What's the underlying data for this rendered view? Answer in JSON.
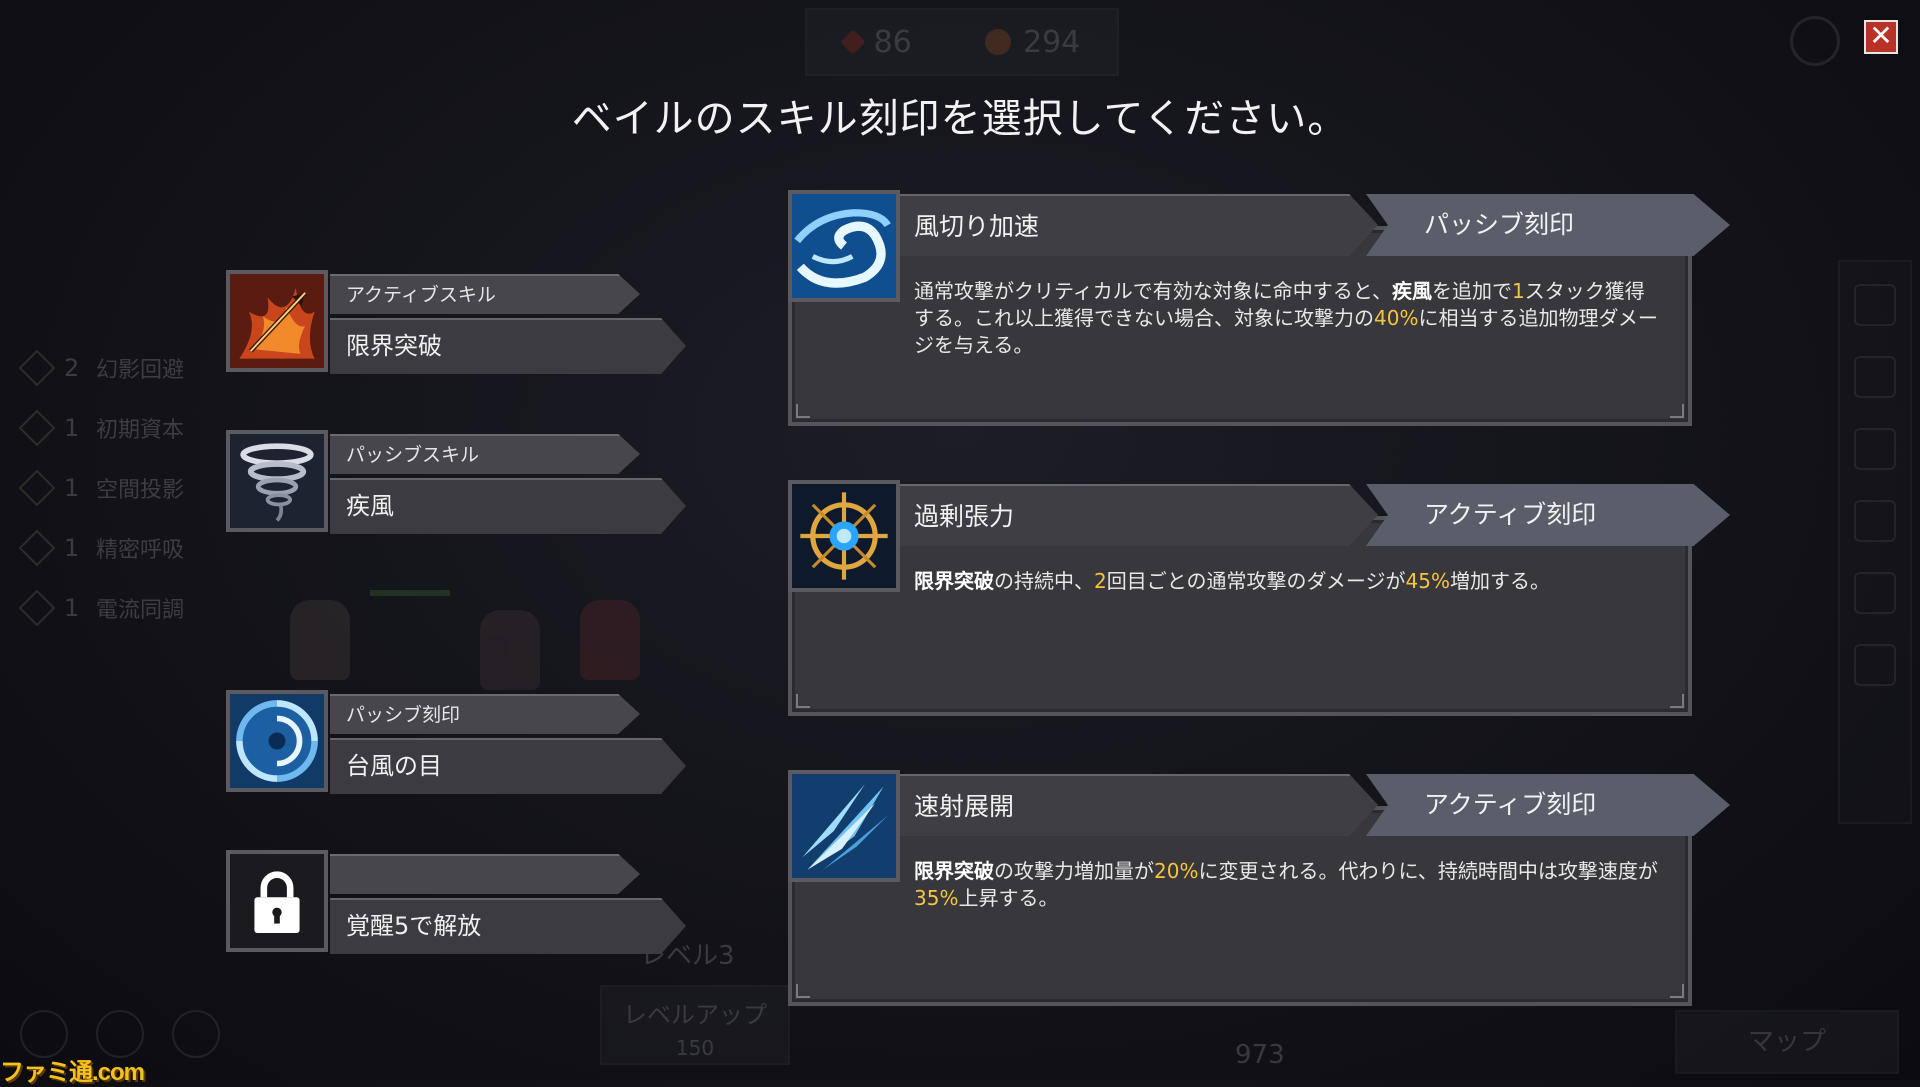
{
  "resources": [
    {
      "icon": "fire-icon",
      "value": "86"
    },
    {
      "icon": "coin-icon",
      "value": "294"
    }
  ],
  "background_list": [
    {
      "count": "2",
      "label": "幻影回避"
    },
    {
      "count": "1",
      "label": "初期資本"
    },
    {
      "count": "1",
      "label": "空間投影"
    },
    {
      "count": "1",
      "label": "精密呼吸"
    },
    {
      "count": "1",
      "label": "電流同調"
    }
  ],
  "background_ui": {
    "level": "レベル3",
    "levelup_label": "レベルアップ",
    "levelup_cost": "150",
    "gold": "973",
    "map_button": "マップ"
  },
  "title": "ベイルのスキル刻印を選択してください。",
  "close_symbol": "✕",
  "skill_slots": [
    {
      "type": "アクティブスキル",
      "name": "限界突破",
      "icon": "arrow-burst-icon"
    },
    {
      "type": "パッシブスキル",
      "name": "疾風",
      "icon": "tornado-icon"
    },
    {
      "type": "パッシブ刻印",
      "name": "台風の目",
      "icon": "typhoon-eye-icon"
    },
    {
      "type": "",
      "name": "覚醒5で解放",
      "icon": "lock-icon"
    }
  ],
  "options": [
    {
      "name": "風切り加速",
      "type": "パッシブ刻印",
      "icon": "wind-swirl-icon",
      "desc": [
        {
          "t": "通常攻撃がクリティカルで有効な対象に命中すると、"
        },
        {
          "t": "疾風",
          "s": "bold"
        },
        {
          "t": "を追加で"
        },
        {
          "t": "1",
          "s": "hl"
        },
        {
          "t": "スタック獲得する。これ以上獲得できない場合、対象に攻撃力の"
        },
        {
          "t": "40%",
          "s": "hl"
        },
        {
          "t": "に相当する追加物理ダメージを与える。"
        }
      ]
    },
    {
      "name": "過剰張力",
      "type": "アクティブ刻印",
      "icon": "crosshair-wheel-icon",
      "desc": [
        {
          "t": "限界突破",
          "s": "bold"
        },
        {
          "t": "の持続中、"
        },
        {
          "t": "2",
          "s": "hl"
        },
        {
          "t": "回目ごとの通常攻撃のダメージが"
        },
        {
          "t": "45%",
          "s": "hl"
        },
        {
          "t": "増加する。"
        }
      ]
    },
    {
      "name": "速射展開",
      "type": "アクティブ刻印",
      "icon": "rapid-shot-icon",
      "desc": [
        {
          "t": "限界突破",
          "s": "bold"
        },
        {
          "t": "の攻撃力増加量が"
        },
        {
          "t": "20%",
          "s": "hl"
        },
        {
          "t": "に変更される。代わりに、持続時間中は攻撃速度が"
        },
        {
          "t": "35%",
          "s": "hl"
        },
        {
          "t": "上昇する。"
        }
      ]
    }
  ],
  "watermark": "ファミ通.com",
  "colors": {
    "highlight": "#f5c542",
    "close_button": "#b83228",
    "type_badge": "#595e6a"
  }
}
